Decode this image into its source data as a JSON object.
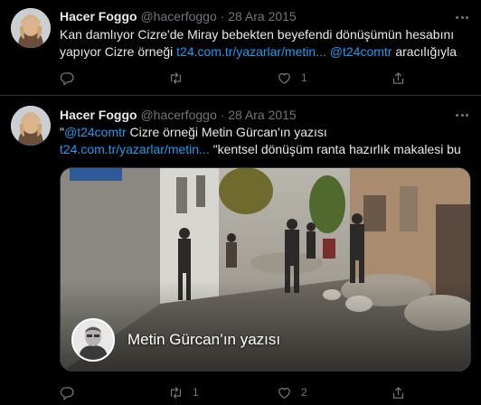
{
  "tweets": [
    {
      "author": {
        "name": "Hacer Foggo",
        "handle": "@hacerfoggo"
      },
      "separator": "·",
      "date": "28 Ara 2015",
      "text_parts": {
        "p1": "Kan damlıyor Cizre'de Miray bebekten beyefendi dönüşümün hesabını yapıyor  Cizre örneği ",
        "link1": "t24.com.tr/yazarlar/metin...",
        "p2": " ",
        "link2": "@t24comtr",
        "p3": " aracılığıyla"
      },
      "actions": {
        "reply": "",
        "retweet": "",
        "like": "1",
        "share": ""
      }
    },
    {
      "author": {
        "name": "Hacer Foggo",
        "handle": "@hacerfoggo"
      },
      "separator": "·",
      "date": "28 Ara 2015",
      "text_parts": {
        "p0": "\"",
        "link0": "@t24comtr",
        "p1": " Cizre örneği Metin Gürcan'ın yazısı",
        "link1": "t24.com.tr/yazarlar/metin...",
        "p2": " \"kentsel dönüşüm ranta hazırlık makalesi bu"
      },
      "card": {
        "title": "Metin Gürcan’ın yazısı"
      },
      "actions": {
        "reply": "",
        "retweet": "1",
        "like": "2",
        "share": ""
      }
    }
  ],
  "icons": {
    "reply": "reply-icon",
    "retweet": "retweet-icon",
    "like": "heart-icon",
    "share": "share-icon",
    "more": "more-icon"
  },
  "colors": {
    "background": "#000000",
    "text": "#e7e9ea",
    "secondary": "#71767b",
    "link": "#1d9bf0",
    "divider": "#2f3336"
  }
}
